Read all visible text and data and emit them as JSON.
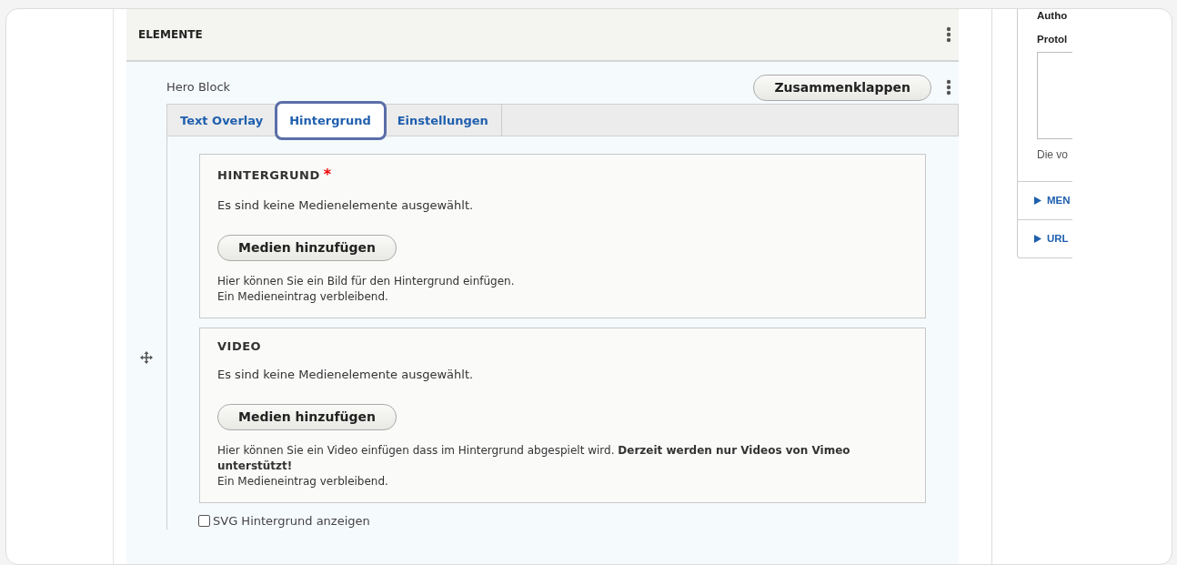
{
  "section": {
    "title": "ELEMENTE"
  },
  "paragraph": {
    "label": "Hero Block",
    "collapse_button": "Zusammenklappen",
    "tabs": [
      {
        "label": "Text Overlay",
        "selected": false
      },
      {
        "label": "Hintergrund",
        "selected": true
      },
      {
        "label": "Einstellungen",
        "selected": false
      }
    ],
    "fields": [
      {
        "title": "HINTERGRUND",
        "required_mark": "*",
        "empty_text": "Es sind keine Medienelemente ausgewählt.",
        "button": "Medien hinzufügen",
        "description": "Hier können Sie ein Bild für den Hintergrund einfügen.",
        "remaining": "Ein Medieneintrag verbleibend."
      },
      {
        "title": "VIDEO",
        "empty_text": "Es sind keine Medienelemente ausgewählt.",
        "button": "Medien hinzufügen",
        "description": "Hier können Sie ein Video einfügen dass im Hintergrund abgespielt wird. **Derzeit werden nur Videos von Vimeo unterstützt!**",
        "remaining": "Ein Medieneintrag verbleibend."
      }
    ],
    "checkbox": {
      "label": "SVG Hintergrund anzeigen",
      "checked": false
    }
  },
  "sidebar": {
    "heading": "Autho",
    "label": "Protol",
    "hint": "Die vo",
    "details": [
      {
        "title": "MEN",
        "expanded": false
      },
      {
        "title": "URL",
        "expanded": false
      }
    ]
  }
}
